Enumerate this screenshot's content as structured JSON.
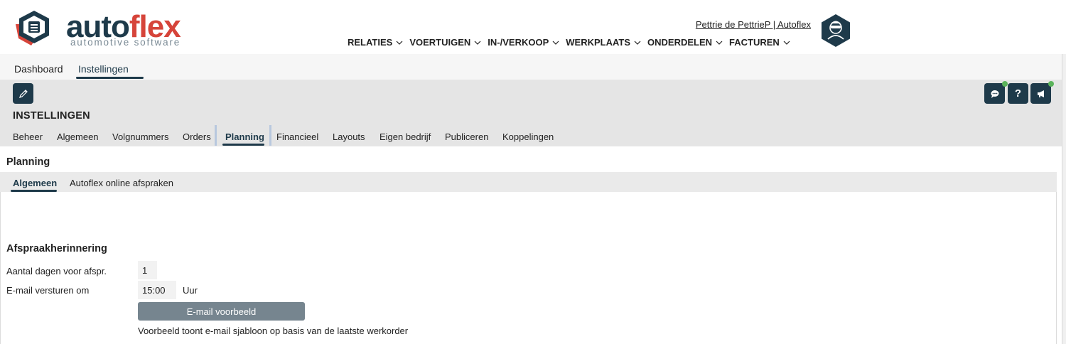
{
  "brand": {
    "logo_part1": "auto",
    "logo_part2": "flex",
    "logo_sub": "automotive software",
    "colors": {
      "dark": "#1e3a4a",
      "red": "#d6443a"
    }
  },
  "header": {
    "user_link": "Pettrie de PettrieP | Autoflex",
    "nav": [
      "RELATIES",
      "VOERTUIGEN",
      "IN-/VERKOOP",
      "WERKPLAATS",
      "ONDERDELEN",
      "FACTUREN"
    ]
  },
  "top_tabs": [
    "Dashboard",
    "Instellingen"
  ],
  "top_tabs_active": "Instellingen",
  "settings": {
    "title": "INSTELLINGEN",
    "tabs": [
      "Beheer",
      "Algemeen",
      "Volgnummers",
      "Orders",
      "Planning",
      "Financieel",
      "Layouts",
      "Eigen bedrijf",
      "Publiceren",
      "Koppelingen"
    ],
    "active_tab": "Planning"
  },
  "planning": {
    "title": "Planning",
    "tabs": [
      "Algemeen",
      "Autoflex online afspraken"
    ],
    "active_tab": "Algemeen",
    "reminder": {
      "title": "Afspraakherinnering",
      "days_label": "Aantal dagen voor afspr.",
      "days_value": "1",
      "time_label": "E-mail versturen om",
      "time_value": "15:00",
      "time_unit": "Uur",
      "preview_button": "E-mail voorbeeld",
      "note": "Voorbeeld toont e-mail sjabloon op basis van de laatste werkorder"
    }
  },
  "icons": [
    "autoflex-logo-icon",
    "user-avatar-icon",
    "chevron-down-icon",
    "pencil-icon",
    "chat-icon",
    "help-icon",
    "megaphone-icon"
  ]
}
